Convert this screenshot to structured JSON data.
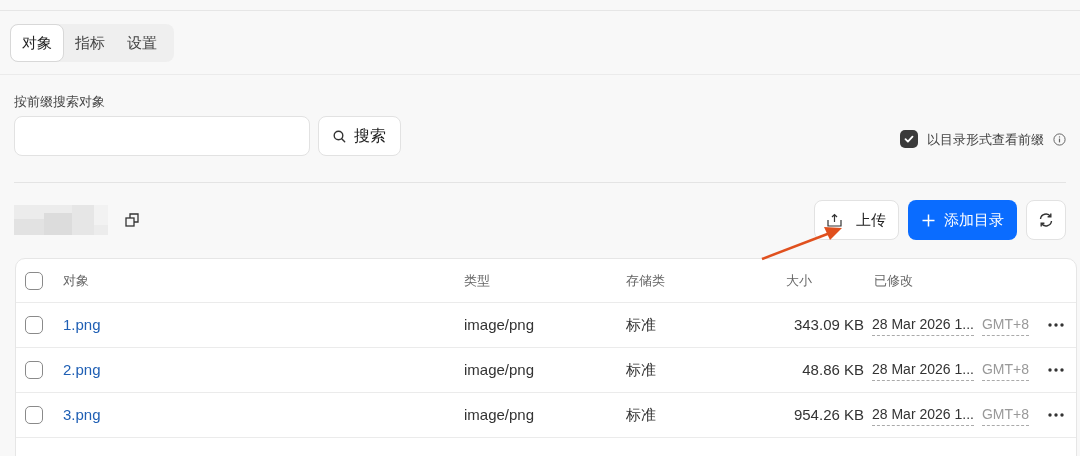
{
  "tabs": [
    {
      "label": "对象",
      "selected": true
    },
    {
      "label": "指标",
      "selected": false
    },
    {
      "label": "设置",
      "selected": false
    }
  ],
  "search": {
    "label": "按前缀搜索对象",
    "button": "搜索"
  },
  "folder_view": {
    "label": "以目录形式查看前缀",
    "checked": true
  },
  "toolbar": {
    "upload": "上传",
    "add_folder": "添加目录"
  },
  "table": {
    "select_all_checked": false,
    "columns": [
      "对象",
      "类型",
      "存储类",
      "大小",
      "已修改"
    ],
    "rows": [
      {
        "checked": false,
        "name": "1.png",
        "type": "image/png",
        "storage": "标准",
        "size": "343.09 KB",
        "modified": "28 Mar 2026 1...",
        "timezone": "GMT+8"
      },
      {
        "checked": false,
        "name": "2.png",
        "type": "image/png",
        "storage": "标准",
        "size": "48.86 KB",
        "modified": "28 Mar 2026 1...",
        "timezone": "GMT+8"
      },
      {
        "checked": false,
        "name": "3.png",
        "type": "image/png",
        "storage": "标准",
        "size": "954.26 KB",
        "modified": "28 Mar 2026 1...",
        "timezone": "GMT+8"
      }
    ]
  }
}
